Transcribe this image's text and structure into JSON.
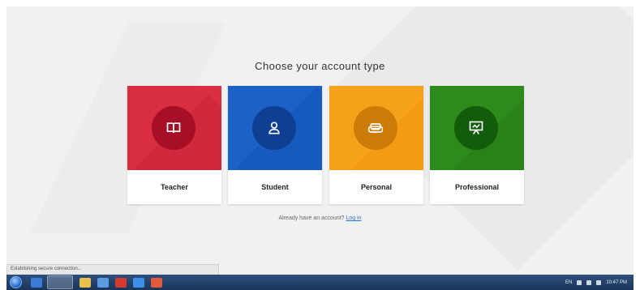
{
  "page": {
    "title": "Choose your account type",
    "cards": [
      {
        "label": "Teacher",
        "icon": "book-icon",
        "color": "#d92d41"
      },
      {
        "label": "Student",
        "icon": "user-icon",
        "color": "#1c62c6"
      },
      {
        "label": "Personal",
        "icon": "sofa-icon",
        "color": "#f6a11a"
      },
      {
        "label": "Professional",
        "icon": "presentation-icon",
        "color": "#2f8a1c"
      }
    ],
    "already_text": "Already have an account?",
    "login_link": "Log in"
  },
  "status_bar": {
    "text": "Establishing secure connection..."
  },
  "taskbar": {
    "tray": {
      "language": "EN",
      "time": "10:47 PM"
    }
  }
}
